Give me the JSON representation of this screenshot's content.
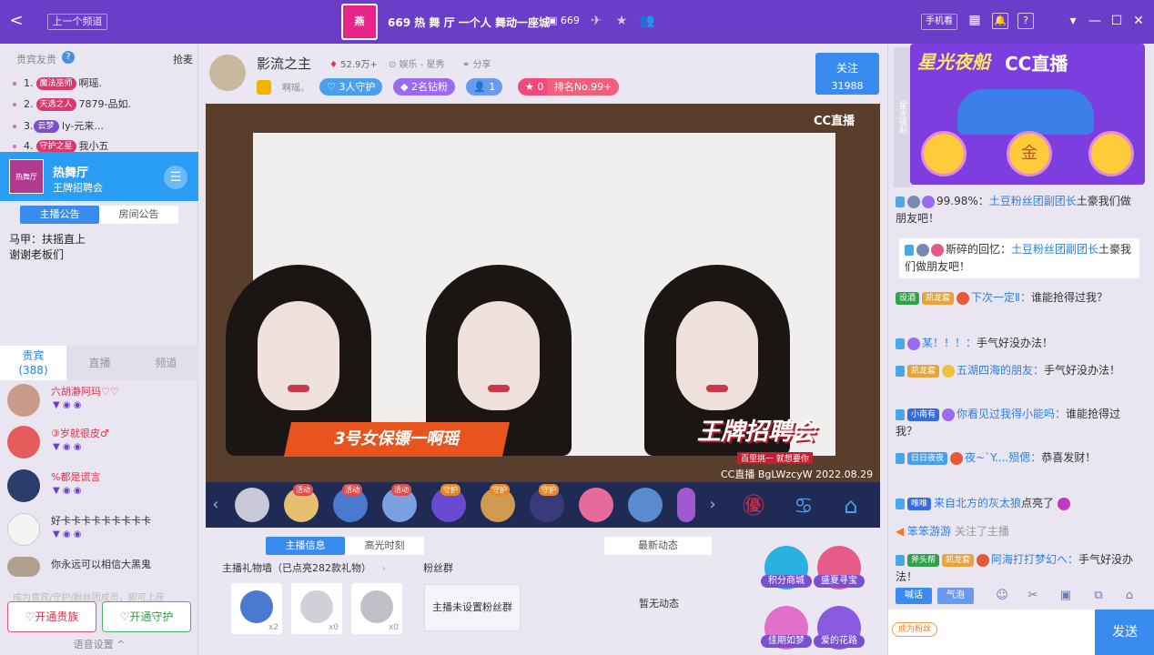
{
  "topbar": {
    "back_label": "<",
    "prev_channel": "上一个频道",
    "logo_text": "燕",
    "title": "669 热 舞 厅   一个人 舞动一座城",
    "online": "669",
    "mobile": "手机看",
    "win_min": "—",
    "win_max": "☐",
    "win_close": "✕",
    "win_menu": "▾"
  },
  "left": {
    "header": "贵宾友贵",
    "help": "?",
    "grab": "抢麦",
    "ranks": [
      {
        "n": "1.",
        "badge": "魔法巫师",
        "name": "啊瑶."
      },
      {
        "n": "2.",
        "badge": "天选之人",
        "name": "7879-品如."
      },
      {
        "n": "3.",
        "badge": "云梦",
        "name": "ly-元来..."
      },
      {
        "n": "4.",
        "badge": "守护之星",
        "name": "我小五"
      }
    ],
    "channel": {
      "thumb": "热舞厅",
      "name": "热舞厅",
      "sub": "王牌招聘会",
      "menu": "☰"
    },
    "notice_tabs": [
      "主播公告",
      "房间公告"
    ],
    "notice_text": [
      "马甲：扶摇直上",
      "谢谢老板们"
    ],
    "viewer_tabs": [
      {
        "label": "贵宾",
        "count": "(388)"
      },
      {
        "label": "直播"
      },
      {
        "label": "频道"
      }
    ],
    "viewers": [
      {
        "name": "六胡瀞阿玛♡♡"
      },
      {
        "name": "③岁就很皮♂"
      },
      {
        "name": "%都是谎言"
      },
      {
        "name": "好卡卡卡卡卡卡卡卡卡"
      },
      {
        "name": "你永远可以相信大黑鬼"
      }
    ],
    "join_hint": "成为贵宾/守护/粉丝团成员，即可上座",
    "btn_noble": "♡开通贵族",
    "btn_guard": "♡开通守护",
    "voice": "语音设置 ^"
  },
  "center": {
    "host_name": "影流之主",
    "heat": "52.9万+",
    "category": "娱乐 - 星秀",
    "share": "分享",
    "signature": "啊瑶。",
    "pills": [
      "3人守护",
      "2名钻粉",
      "1",
      "0",
      "排名No.99+"
    ],
    "follow_label": "关注",
    "follow_count": "31988",
    "cc_logo": "CC直播",
    "caption": "3号女保镖一啊瑶",
    "recruit": "王牌招聘会",
    "recruit_sub": "百里挑一 就想要你",
    "watermark": "CC直播 BgLWzcyW 2022.08.29",
    "gift_tags": [
      "活动",
      "活动",
      "活动",
      "守护",
      "守护",
      "守护"
    ],
    "btabs": [
      "主播信息",
      "高光时刻"
    ],
    "latest": "最新动态",
    "wall_label": "主播礼物墙（已点亮282款礼物）",
    "fan_label": "粉丝群",
    "wall_counts": [
      "x2",
      "x0",
      "x0"
    ],
    "fan_empty": "主播未设置粉丝群",
    "no_dynamic": "暂无动态",
    "actions": [
      "积分商城",
      "盛夏寻宝",
      "佳期如梦",
      "爱的花路"
    ]
  },
  "right": {
    "side_label": "星光夜船",
    "banner_title": "星光夜船",
    "banner_cc": "CC直播",
    "banner_coin": "金",
    "chats": [
      {
        "pre": "99.98%：",
        "user": "土豆粉丝团副团长",
        "text": "土豪我们做朋友吧！"
      },
      {
        "pre": "斯碎的回忆：",
        "user": "土豆粉丝团副团长",
        "text": "土豪我们做朋友吧！"
      },
      {
        "tag": "设酒",
        "user": "下次一定Ⅱ：",
        "text": "谁能抢得过我？"
      },
      {
        "user": "某！！！：",
        "text": "手气好没办法！"
      },
      {
        "tag": "凯龙套",
        "user": "五湖四海的朋友：",
        "text": "手气好没办法！"
      },
      {
        "tag": "小南有",
        "user": "你看见过我得小能吗：",
        "text": "谁能抢得过我？"
      },
      {
        "tag": "日日夜夜",
        "user": "夜~`Y....殒偲：",
        "text": "恭喜发财！"
      },
      {
        "tag": "唯唯",
        "user": "来自北方的灰太狼",
        "text": "点亮了"
      },
      {
        "user": "笨笨游游",
        "text": "关注了主播"
      },
      {
        "tag": "斧头帮",
        "user": "阿海打打梦幻へ：",
        "text": "手气好没办法！"
      }
    ],
    "tool_btns": [
      "喊话",
      "气泡"
    ],
    "input_badge": "成为粉丝",
    "send": "发送"
  }
}
